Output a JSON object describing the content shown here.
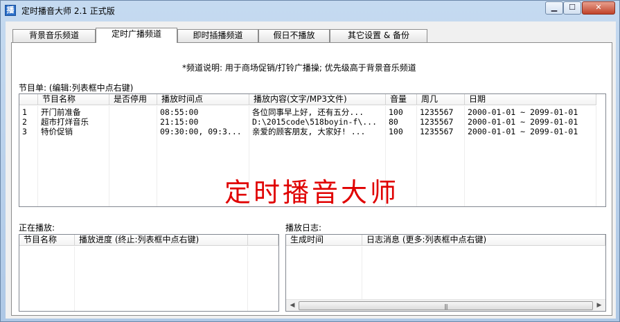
{
  "window": {
    "title": "定时播音大师 2.1 正式版",
    "icon": "app-icon",
    "icon_glyph": "播",
    "controls": {
      "minimize": "▁",
      "maximize": "☐",
      "close": "✕"
    }
  },
  "tabs": [
    {
      "label": "背景音乐频道",
      "active": false
    },
    {
      "label": "定时广播频道",
      "active": true
    },
    {
      "label": "即时插播频道",
      "active": false
    },
    {
      "label": "假日不播放",
      "active": false
    },
    {
      "label": "其它设置 & 备份",
      "active": false
    }
  ],
  "description": "*频道说明:  用于商场促销/打铃广播操; 优先级高于背景音乐频道",
  "program_list": {
    "label": "节目单: (编辑:列表框中点右键)",
    "columns": [
      "",
      "节目名称",
      "是否停用",
      "播放时间点",
      "播放内容(文字/MP3文件)",
      "音量",
      "周几",
      "日期"
    ],
    "rows": [
      [
        "1",
        "开门前准备",
        "",
        "08:55:00",
        "各位同事早上好, 还有五分...",
        "100",
        "1235567",
        "2000-01-01 ~ 2099-01-01"
      ],
      [
        "2",
        "超市打烊音乐",
        "",
        "21:15:00",
        "D:\\2015code\\518boyin-f\\...",
        "80",
        "1235567",
        "2000-01-01 ~ 2099-01-01"
      ],
      [
        "3",
        "特价促销",
        "",
        "09:30:00, 09:3...",
        "亲爱的顾客朋友, 大家好! ...",
        "100",
        "1235567",
        "2000-01-01 ~ 2099-01-01"
      ]
    ],
    "watermark": "定时播音大师"
  },
  "now_playing": {
    "label": "正在播放:",
    "columns": [
      "节目名称",
      "播放进度 (终止:列表框中点右键)"
    ]
  },
  "log": {
    "label": "播放日志:",
    "columns": [
      "生成时间",
      "日志消息 (更多:列表框中点右键)"
    ],
    "scroll_left": "◀",
    "scroll_right": "▶",
    "scroll_grip": "|||"
  }
}
